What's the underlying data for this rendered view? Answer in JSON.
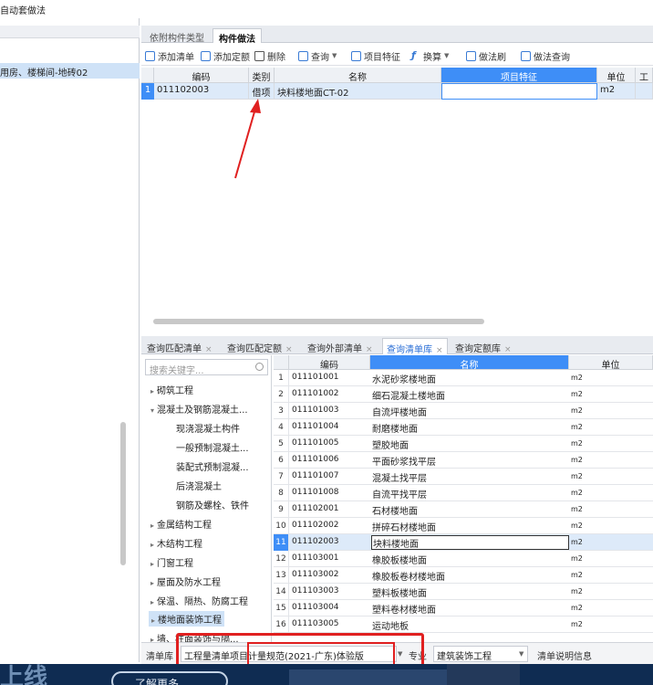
{
  "window": {
    "title": "自动套做法"
  },
  "left": {
    "selected_item": "用房、楼梯间-地砖02"
  },
  "top_tabs": [
    {
      "label": "依附构件类型"
    },
    {
      "label": "构件做法"
    }
  ],
  "toolbar": {
    "add_list": "添加清单",
    "add_quota": "添加定额",
    "delete": "删除",
    "query": "查询",
    "item_feature": "项目特征",
    "convert": "换算",
    "brush": "做法刷",
    "method_query": "做法查询"
  },
  "grid": {
    "headers": {
      "code": "编码",
      "type": "类别",
      "name": "名称",
      "feature": "项目特征",
      "unit": "单位",
      "extra": "工"
    },
    "rows": [
      {
        "num": "1",
        "code": "011102003",
        "type": "借项",
        "name": "块料楼地面CT-02",
        "feature": "",
        "unit": "m2"
      }
    ]
  },
  "bottom_tabs": [
    {
      "label": "查询匹配清单"
    },
    {
      "label": "查询匹配定额"
    },
    {
      "label": "查询外部清单"
    },
    {
      "label": "查询清单库"
    },
    {
      "label": "查询定额库"
    }
  ],
  "tree": {
    "search_placeholder": "搜索关键字...",
    "items": [
      {
        "label": "砌筑工程",
        "arrow": "▸"
      },
      {
        "label": "混凝土及钢筋混凝土...",
        "arrow": "▾"
      },
      {
        "label": "现浇混凝土构件",
        "arrow": ""
      },
      {
        "label": "一般预制混凝土...",
        "arrow": ""
      },
      {
        "label": "装配式预制混凝...",
        "arrow": ""
      },
      {
        "label": "后浇混凝土",
        "arrow": ""
      },
      {
        "label": "钢筋及螺栓、铁件",
        "arrow": ""
      },
      {
        "label": "金属结构工程",
        "arrow": "▸"
      },
      {
        "label": "木结构工程",
        "arrow": "▸"
      },
      {
        "label": "门窗工程",
        "arrow": "▸"
      },
      {
        "label": "屋面及防水工程",
        "arrow": "▸"
      },
      {
        "label": "保温、隔热、防腐工程",
        "arrow": "▸"
      },
      {
        "label": "楼地面装饰工程",
        "arrow": "▸"
      },
      {
        "label": "墙、柱面装饰与隔...",
        "arrow": "▸"
      }
    ]
  },
  "library": {
    "headers": {
      "code": "编码",
      "name": "名称",
      "unit": "单位"
    },
    "rows": [
      {
        "num": "1",
        "code": "011101001",
        "name": "水泥砂浆楼地面",
        "unit": "m2"
      },
      {
        "num": "2",
        "code": "011101002",
        "name": "细石混凝土楼地面",
        "unit": "m2"
      },
      {
        "num": "3",
        "code": "011101003",
        "name": "自流坪楼地面",
        "unit": "m2"
      },
      {
        "num": "4",
        "code": "011101004",
        "name": "耐磨楼地面",
        "unit": "m2"
      },
      {
        "num": "5",
        "code": "011101005",
        "name": "塑胶地面",
        "unit": "m2"
      },
      {
        "num": "6",
        "code": "011101006",
        "name": "平面砂浆找平层",
        "unit": "m2"
      },
      {
        "num": "7",
        "code": "011101007",
        "name": "混凝土找平层",
        "unit": "m2"
      },
      {
        "num": "8",
        "code": "011101008",
        "name": "自流平找平层",
        "unit": "m2"
      },
      {
        "num": "9",
        "code": "011102001",
        "name": "石材楼地面",
        "unit": "m2"
      },
      {
        "num": "10",
        "code": "011102002",
        "name": "拼碎石材楼地面",
        "unit": "m2"
      },
      {
        "num": "11",
        "code": "011102003",
        "name": "块料楼地面",
        "unit": "m2"
      },
      {
        "num": "12",
        "code": "011103001",
        "name": "橡胶板楼地面",
        "unit": "m2"
      },
      {
        "num": "13",
        "code": "011103002",
        "name": "橡胶板卷材楼地面",
        "unit": "m2"
      },
      {
        "num": "14",
        "code": "011103003",
        "name": "塑料板楼地面",
        "unit": "m2"
      },
      {
        "num": "15",
        "code": "011103004",
        "name": "塑料卷材楼地面",
        "unit": "m2"
      },
      {
        "num": "16",
        "code": "011103005",
        "name": "运动地板",
        "unit": "m2"
      }
    ]
  },
  "status": {
    "list_label": "清单库",
    "list_value": "工程量清单项目计量规范(2021-广东)体验版",
    "major_label": "专业",
    "major_value": "建筑装饰工程",
    "desc": "清单说明信息"
  },
  "footer": {
    "logo": "上线",
    "button": "了解更多"
  },
  "colors": {
    "accent": "#3e8ef7",
    "selection": "#cfe2f7",
    "annotation": "#e02020"
  }
}
